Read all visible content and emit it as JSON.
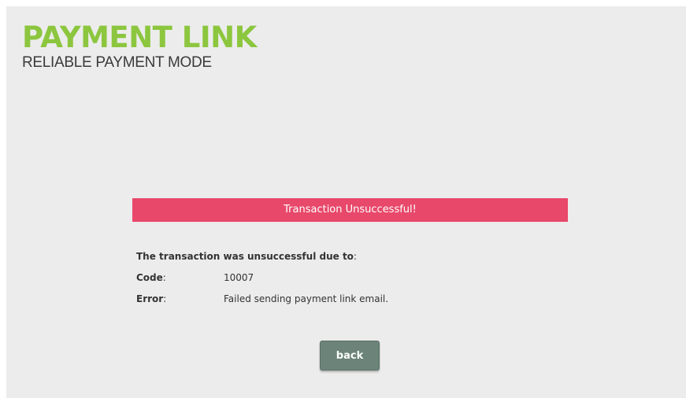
{
  "logo": {
    "title": "PAYMENT LINK",
    "subtitle": "RELIABLE PAYMENT MODE"
  },
  "banner": {
    "text": "Transaction Unsuccessful!"
  },
  "details": {
    "intro_bold": "The transaction was unsuccessful due to",
    "intro_colon": ":",
    "code_label": "Code",
    "code_value": "10007",
    "error_label": "Error",
    "error_value": "Failed sending payment link email.",
    "colon": ":"
  },
  "actions": {
    "back_label": "back"
  },
  "colors": {
    "brand_green": "#8cc63f",
    "error_banner": "#e8486a",
    "button": "#6b8379",
    "panel_bg": "#ececec"
  }
}
